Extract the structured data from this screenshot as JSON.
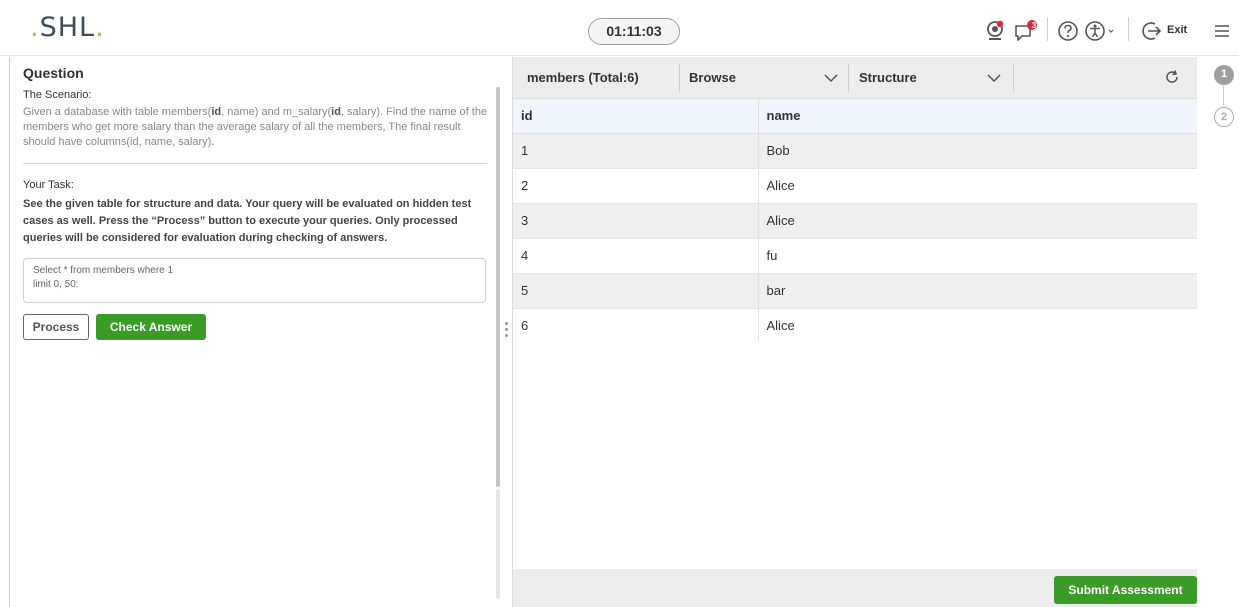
{
  "header": {
    "logo": "SHL",
    "timer": "01:11:03",
    "notification_count": "3",
    "exit_label": "Exit",
    "icons": [
      "webcam-icon",
      "chat-notification-icon",
      "help-icon",
      "accessibility-icon",
      "exit-icon",
      "menu-icon"
    ]
  },
  "question": {
    "title": "Question",
    "scenario_label": "The Scenario:",
    "scenario_pre": "Given a database with table members(",
    "id1": "id",
    "scenario_mid": ", name) and m_salary(",
    "id2": "id",
    "scenario_post": ", salary). Find the name of the members who get more salary than the average salary of all the members, The final result should have columns(id, name, salary).",
    "task_label": "Your Task:",
    "task_text": "See the given table for structure and data. Your query will be evaluated on hidden test cases as well. Press the “Process” button to execute your queries. Only processed queries will be considered for evaluation during checking of answers.",
    "query_line1": "Select * from members where 1",
    "query_line2": "limit 0, 50:",
    "process_label": "Process",
    "check_label": "Check Answer"
  },
  "db": {
    "table_label": "members (Total:6)",
    "browse_label": "Browse",
    "structure_label": "Structure",
    "columns": [
      "id",
      "name"
    ],
    "rows": [
      [
        "1",
        "Bob"
      ],
      [
        "2",
        "Alice"
      ],
      [
        "3",
        "Alice"
      ],
      [
        "4",
        "fu"
      ],
      [
        "5",
        "bar"
      ],
      [
        "6",
        "Alice"
      ]
    ],
    "submit_label": "Submit Assessment"
  },
  "stepper": {
    "steps": [
      "1",
      "2"
    ]
  },
  "colors": {
    "accent_green": "#3a9b27",
    "logo_dot": "#8dc63f"
  }
}
